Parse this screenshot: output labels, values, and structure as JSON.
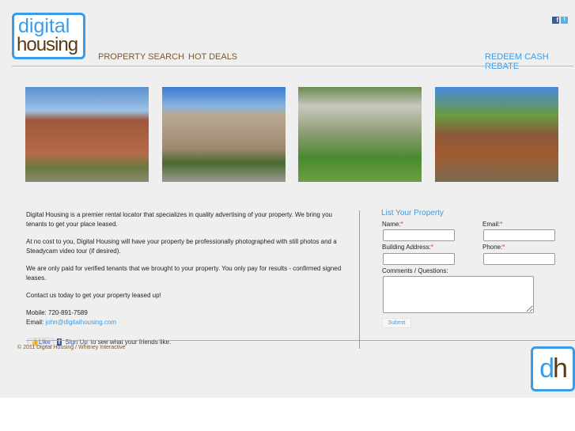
{
  "logo": {
    "line1": "digital",
    "line2": "housing"
  },
  "nav": {
    "property_search": "PROPERTY SEARCH",
    "hot_deals": "HOT DEALS",
    "redeem": "REDEEM CASH REBATE"
  },
  "social": [
    "facebook-icon",
    "twitter-icon"
  ],
  "photos": [
    "brick-house-photo",
    "craftsman-house-photo",
    "apartment-complex-photo",
    "gazebo-photo"
  ],
  "about": {
    "p1": "Digital Housing is a premier rental locator that specializes in quality advertising of your property. We bring you tenants to get your place leased.",
    "p2": "At no cost to you, Digital Housing will have your property be professionally photographed with still photos and a Steadycam video tour (if desired).",
    "p3": "We are only paid for verified tenants that we brought to your property. You only pay for results - confirmed signed leases.",
    "p4": "Contact us today to get your property leased up!",
    "mobile": "Mobile: 720-891-7589",
    "email_label": "Email:",
    "email": "john@digitalhousing.com"
  },
  "facebook": {
    "like": "Like",
    "signup": "Sign Up",
    "rest": "to see what your friends like."
  },
  "footer": "© 2011 Digital Housing / Whitney Interactive",
  "form": {
    "title": "List Your Property",
    "name": "Name:",
    "email": "Email:",
    "address": "Building Address:",
    "phone": "Phone:",
    "comments": "Comments / Questions:",
    "required": "*",
    "submit": "Submit"
  },
  "badge": {
    "d": "d",
    "h": "h"
  },
  "colors": {
    "accent": "#3a9be6",
    "brown": "#5a3a12",
    "nav": "#7a5a2a"
  }
}
